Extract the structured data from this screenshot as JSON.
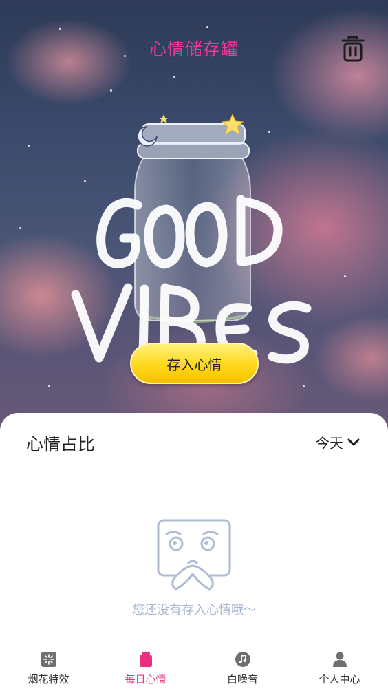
{
  "header": {
    "title": "心情储存罐"
  },
  "hero": {
    "store_button_label": "存入心情"
  },
  "panel": {
    "title": "心情占比",
    "range_selected": "今天",
    "empty_message": "您还没有存入心情哦～"
  },
  "tabs": [
    {
      "label": "烟花特效",
      "icon": "fireworks-icon",
      "active": false
    },
    {
      "label": "每日心情",
      "icon": "jar-icon",
      "active": true
    },
    {
      "label": "白噪音",
      "icon": "music-icon",
      "active": false
    },
    {
      "label": "个人中心",
      "icon": "person-icon",
      "active": false
    }
  ],
  "colors": {
    "accent": "#e83a9c",
    "active_tab": "#e8307f",
    "button_yellow": "#ffd81c",
    "empty_text": "#a6b4cf"
  }
}
